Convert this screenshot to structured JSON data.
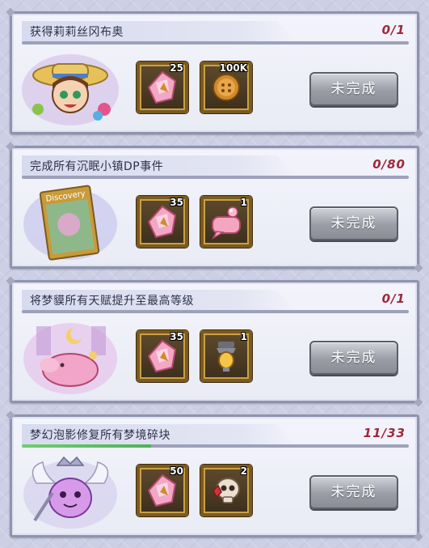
{
  "colors": {
    "progress_text": "#a0283a",
    "progress_fill": "#5fc263",
    "button": "#9a9ca6",
    "frame": "#7a5a1e"
  },
  "tasks": [
    {
      "title": "获得莉莉丝冈布奥",
      "progress": "0/1",
      "progress_fraction": 0,
      "portrait": "boy-straw-hat-portrait",
      "rewards": [
        {
          "icon": "pink-crystal-icon",
          "qty": "25"
        },
        {
          "icon": "bronze-coin-icon",
          "qty": "100K"
        }
      ],
      "button": "未完成"
    },
    {
      "title": "完成所有沉眠小镇DP事件",
      "progress": "0/80",
      "progress_fraction": 0,
      "portrait": "discovery-book-portrait",
      "portrait_text": "Discovery",
      "rewards": [
        {
          "icon": "pink-crystal-icon",
          "qty": "35"
        },
        {
          "icon": "pink-speech-bubble-icon",
          "qty": "1"
        }
      ],
      "button": "未完成"
    },
    {
      "title": "将梦貘所有天赋提升至最高等级",
      "progress": "0/1",
      "progress_fraction": 0,
      "portrait": "pink-dream-tapir-portrait",
      "rewards": [
        {
          "icon": "pink-crystal-icon",
          "qty": "35"
        },
        {
          "icon": "golden-lightbulb-icon",
          "qty": "1"
        }
      ],
      "button": "未完成"
    },
    {
      "title": "梦幻泡影修复所有梦境碎块",
      "progress": "11/33",
      "progress_fraction": 0.333,
      "portrait": "winged-purple-slime-portrait",
      "rewards": [
        {
          "icon": "pink-crystal-icon",
          "qty": "50"
        },
        {
          "icon": "skull-with-gem-icon",
          "qty": "2"
        }
      ],
      "button": "未完成"
    }
  ]
}
